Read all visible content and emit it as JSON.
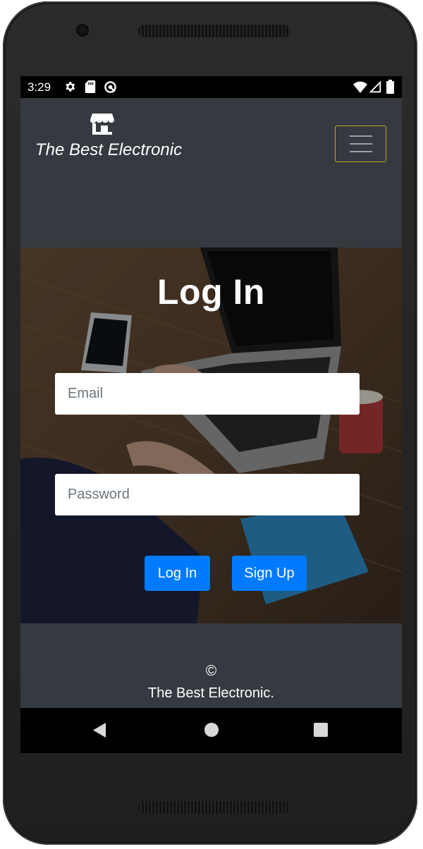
{
  "status_bar": {
    "time": "3:29",
    "left_icons": [
      "gear-icon",
      "sd-card-icon",
      "sync-icon"
    ],
    "right_icons": [
      "wifi-icon",
      "signal-icon",
      "battery-icon"
    ]
  },
  "navbar": {
    "brand_icon": "storefront-icon",
    "brand_text": "The Best Electronic",
    "menu_icon": "hamburger-menu-icon"
  },
  "login": {
    "title": "Log In",
    "email_placeholder": "Email",
    "email_value": "",
    "password_placeholder": "Password",
    "password_value": "",
    "login_button": "Log In",
    "signup_button": "Sign Up"
  },
  "footer": {
    "copyright": "©",
    "company": "The Best Electronic."
  },
  "system_nav": {
    "icons": [
      "back-icon",
      "home-icon",
      "recents-icon"
    ]
  },
  "colors": {
    "navbar_bg": "#343a40",
    "button_primary": "#007bff",
    "toggler_border": "#c9a227"
  }
}
